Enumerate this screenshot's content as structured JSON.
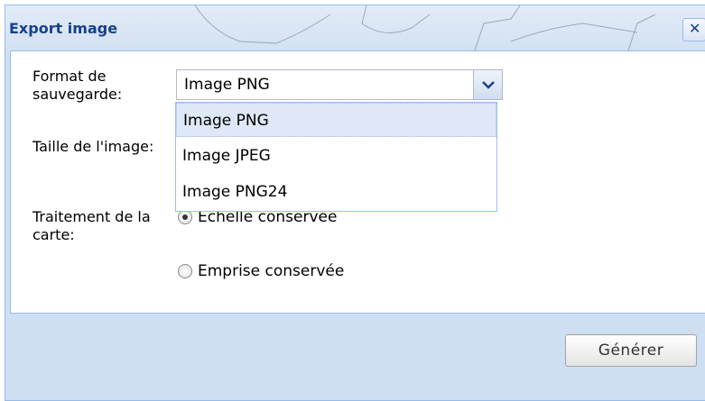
{
  "dialog": {
    "title": "Export image",
    "close_glyph": "✕"
  },
  "form": {
    "format_label": "Format de sauvegarde:",
    "format_value": "Image PNG",
    "size_label": "Taille de l'image:",
    "processing_label": "Traitement de la carte:",
    "radio_scale": "Echelle conservée",
    "radio_extent": "Emprise conservée",
    "radio_selected": "Echelle conservée"
  },
  "dropdown": {
    "options": [
      "Image PNG",
      "Image JPEG",
      "Image PNG24"
    ],
    "selected": "Image PNG"
  },
  "buttons": {
    "generate_label": "Générer"
  },
  "colors": {
    "title_text": "#15428b",
    "panel_bg": "#cfdff3",
    "border": "#99bbe8",
    "selected_item_bg": "#dfe8f6"
  },
  "icons": {
    "close": "close-icon",
    "dropdown": "chevron-down-icon"
  }
}
